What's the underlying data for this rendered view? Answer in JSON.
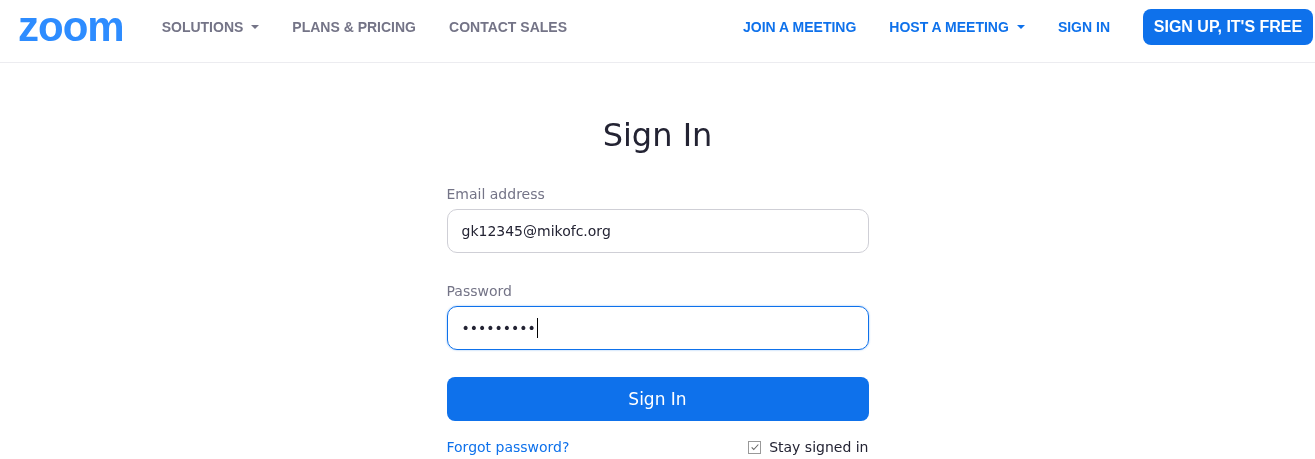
{
  "header": {
    "logo": "zoom",
    "nav_left": [
      {
        "label": "SOLUTIONS",
        "dropdown": true
      },
      {
        "label": "PLANS & PRICING",
        "dropdown": false
      },
      {
        "label": "CONTACT SALES",
        "dropdown": false
      }
    ],
    "nav_right": [
      {
        "label": "JOIN A MEETING",
        "dropdown": false
      },
      {
        "label": "HOST A MEETING",
        "dropdown": true
      },
      {
        "label": "SIGN IN",
        "dropdown": false
      }
    ],
    "signup_button": "SIGN UP, IT'S FREE"
  },
  "form": {
    "title": "Sign In",
    "fields": [
      {
        "label": "Email address",
        "value": "gk12345@mikofc.org",
        "focused": false
      },
      {
        "label": "Password",
        "value": "•••••••••",
        "focused": true
      }
    ],
    "submit": "Sign In",
    "forgot_link": "Forgot password?",
    "stay_signed_in": {
      "label": "Stay signed in",
      "checked": true
    }
  }
}
